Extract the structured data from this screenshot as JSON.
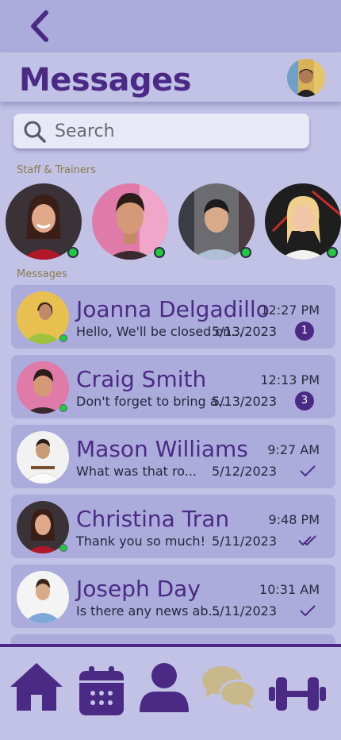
{
  "header": {
    "title": "Messages"
  },
  "search": {
    "placeholder": "Search"
  },
  "sections": {
    "staff_label": "Staff & Trainers",
    "messages_label": "Messages"
  },
  "colors": {
    "accent": "#4b2a85",
    "online": "#1ecb3c",
    "nav_active": "#c8b88a",
    "card": "#acacdc",
    "background": "#c2c2e6"
  },
  "staff": [
    {
      "online": true
    },
    {
      "online": true
    },
    {
      "online": true
    },
    {
      "online": true
    }
  ],
  "messages": [
    {
      "name": "Joanna Delgadillo",
      "time": "12:27 PM",
      "preview": "Hello, We'll be closed on...",
      "date": "5/13/2023",
      "unread": "1",
      "online": true
    },
    {
      "name": "Craig Smith",
      "time": "12:13 PM",
      "preview": "Don't forget to bring a...",
      "date": "5/13/2023",
      "unread": "3",
      "online": true
    },
    {
      "name": "Mason Williams",
      "time": "9:27 AM",
      "preview": "What was that ro...",
      "date": "5/12/2023",
      "status": "sent"
    },
    {
      "name": "Christina Tran",
      "time": "9:48 PM",
      "preview": "Thank you so much!",
      "date": "5/11/2023",
      "status": "read",
      "online": true
    },
    {
      "name": "Joseph Day",
      "time": "10:31 AM",
      "preview": "Is there any news ab...",
      "date": "5/11/2023",
      "status": "sent"
    }
  ],
  "nav": {
    "items": [
      {
        "icon": "home-icon"
      },
      {
        "icon": "calendar-icon"
      },
      {
        "icon": "profile-icon"
      },
      {
        "icon": "chat-icon",
        "active": true
      },
      {
        "icon": "dumbbell-icon"
      }
    ]
  }
}
